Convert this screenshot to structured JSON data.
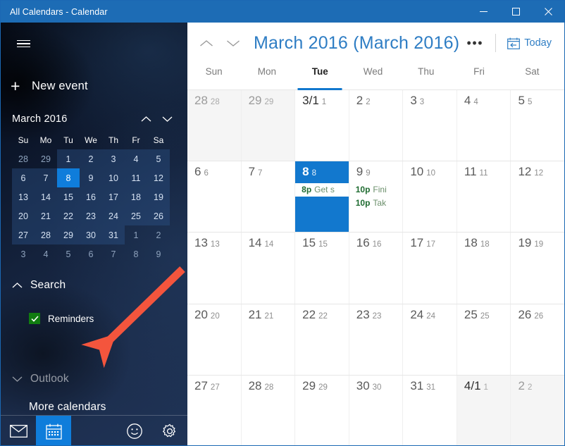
{
  "window": {
    "title": "All Calendars - Calendar",
    "controls": {
      "minimize": "minimize-icon",
      "maximize": "maximize-icon",
      "close": "close-icon"
    },
    "accent_color": "#1d6cb5"
  },
  "sidebar": {
    "menu_icon": "hamburger-icon",
    "new_event": {
      "icon": "plus-icon",
      "label": "New event"
    },
    "mini_calendar": {
      "month_label": "March 2016",
      "prev_icon": "chevron-up-icon",
      "next_icon": "chevron-down-icon",
      "weekday_headers": [
        "Su",
        "Mo",
        "Tu",
        "We",
        "Th",
        "Fr",
        "Sa"
      ],
      "weeks": [
        [
          {
            "d": "28",
            "m": "prev"
          },
          {
            "d": "29",
            "m": "prev"
          },
          {
            "d": "1",
            "m": "cur"
          },
          {
            "d": "2",
            "m": "cur"
          },
          {
            "d": "3",
            "m": "cur"
          },
          {
            "d": "4",
            "m": "cur"
          },
          {
            "d": "5",
            "m": "cur"
          }
        ],
        [
          {
            "d": "6",
            "m": "cur"
          },
          {
            "d": "7",
            "m": "cur"
          },
          {
            "d": "8",
            "m": "cur",
            "today": true
          },
          {
            "d": "9",
            "m": "cur"
          },
          {
            "d": "10",
            "m": "cur"
          },
          {
            "d": "11",
            "m": "cur"
          },
          {
            "d": "12",
            "m": "cur"
          }
        ],
        [
          {
            "d": "13",
            "m": "cur"
          },
          {
            "d": "14",
            "m": "cur"
          },
          {
            "d": "15",
            "m": "cur"
          },
          {
            "d": "16",
            "m": "cur"
          },
          {
            "d": "17",
            "m": "cur"
          },
          {
            "d": "18",
            "m": "cur"
          },
          {
            "d": "19",
            "m": "cur"
          }
        ],
        [
          {
            "d": "20",
            "m": "cur"
          },
          {
            "d": "21",
            "m": "cur"
          },
          {
            "d": "22",
            "m": "cur"
          },
          {
            "d": "23",
            "m": "cur"
          },
          {
            "d": "24",
            "m": "cur"
          },
          {
            "d": "25",
            "m": "cur"
          },
          {
            "d": "26",
            "m": "cur"
          }
        ],
        [
          {
            "d": "27",
            "m": "cur"
          },
          {
            "d": "28",
            "m": "cur"
          },
          {
            "d": "29",
            "m": "cur"
          },
          {
            "d": "30",
            "m": "cur"
          },
          {
            "d": "31",
            "m": "cur"
          },
          {
            "d": "1",
            "m": "next"
          },
          {
            "d": "2",
            "m": "next"
          }
        ],
        [
          {
            "d": "3",
            "m": "next"
          },
          {
            "d": "4",
            "m": "next"
          },
          {
            "d": "5",
            "m": "next"
          },
          {
            "d": "6",
            "m": "next"
          },
          {
            "d": "7",
            "m": "next"
          },
          {
            "d": "8",
            "m": "next"
          },
          {
            "d": "9",
            "m": "next"
          }
        ]
      ],
      "today_color": "#0f7ddb"
    },
    "search_section": {
      "label": "Search",
      "collapse_icon": "chevron-up-icon"
    },
    "calendars": [
      {
        "label": "Reminders",
        "checked": true,
        "color": "#107c10",
        "checkbox_icon": "checkmark-icon"
      }
    ],
    "clipped_section": {
      "label": "Outlook",
      "collapse_icon": "chevron-down-icon"
    },
    "more_calendars": "More calendars",
    "bottom_bar": [
      {
        "name": "mail",
        "icon": "mail-icon",
        "active": false
      },
      {
        "name": "calendar",
        "icon": "calendar-icon",
        "active": true
      },
      {
        "name": "feedback",
        "icon": "smiley-icon",
        "active": false
      },
      {
        "name": "settings",
        "icon": "gear-icon",
        "active": false
      }
    ],
    "annotation": {
      "type": "red-arrow",
      "color": "#f4553d",
      "points_to": "Reminders"
    }
  },
  "main": {
    "prev_icon": "chevron-up-icon",
    "next_icon": "chevron-down-icon",
    "title": "March 2016 (March 2016)",
    "title_color": "#2e7dc4",
    "overflow_label": "•••",
    "today_button": {
      "label": "Today",
      "icon": "calendar-back-icon"
    },
    "weekday_headers": [
      {
        "label": "Sun",
        "selected": false
      },
      {
        "label": "Mon",
        "selected": false
      },
      {
        "label": "Tue",
        "selected": true
      },
      {
        "label": "Wed",
        "selected": false
      },
      {
        "label": "Thu",
        "selected": false
      },
      {
        "label": "Fri",
        "selected": false
      },
      {
        "label": "Sat",
        "selected": false
      }
    ],
    "selection_color": "#1278ce",
    "weeks": [
      [
        {
          "main": "28",
          "sub": "28",
          "outside": true,
          "events": []
        },
        {
          "main": "29",
          "sub": "29",
          "outside": true,
          "events": []
        },
        {
          "main": "3/1",
          "sub": "1",
          "outside": false,
          "firstday": true,
          "events": []
        },
        {
          "main": "2",
          "sub": "2",
          "outside": false,
          "events": []
        },
        {
          "main": "3",
          "sub": "3",
          "outside": false,
          "events": []
        },
        {
          "main": "4",
          "sub": "4",
          "outside": false,
          "events": []
        },
        {
          "main": "5",
          "sub": "5",
          "outside": false,
          "events": []
        }
      ],
      [
        {
          "main": "6",
          "sub": "6",
          "outside": false,
          "events": []
        },
        {
          "main": "7",
          "sub": "7",
          "outside": false,
          "events": []
        },
        {
          "main": "8",
          "sub": "8",
          "outside": false,
          "selected": true,
          "events": [
            {
              "time": "8p",
              "title": "Get s"
            }
          ]
        },
        {
          "main": "9",
          "sub": "9",
          "outside": false,
          "events": [
            {
              "time": "10p",
              "title": "Fini"
            },
            {
              "time": "10p",
              "title": "Tak"
            }
          ]
        },
        {
          "main": "10",
          "sub": "10",
          "outside": false,
          "events": []
        },
        {
          "main": "11",
          "sub": "11",
          "outside": false,
          "events": []
        },
        {
          "main": "12",
          "sub": "12",
          "outside": false,
          "events": []
        }
      ],
      [
        {
          "main": "13",
          "sub": "13",
          "outside": false,
          "events": []
        },
        {
          "main": "14",
          "sub": "14",
          "outside": false,
          "events": []
        },
        {
          "main": "15",
          "sub": "15",
          "outside": false,
          "events": []
        },
        {
          "main": "16",
          "sub": "16",
          "outside": false,
          "events": []
        },
        {
          "main": "17",
          "sub": "17",
          "outside": false,
          "events": []
        },
        {
          "main": "18",
          "sub": "18",
          "outside": false,
          "events": []
        },
        {
          "main": "19",
          "sub": "19",
          "outside": false,
          "events": []
        }
      ],
      [
        {
          "main": "20",
          "sub": "20",
          "outside": false,
          "events": []
        },
        {
          "main": "21",
          "sub": "21",
          "outside": false,
          "events": []
        },
        {
          "main": "22",
          "sub": "22",
          "outside": false,
          "events": []
        },
        {
          "main": "23",
          "sub": "23",
          "outside": false,
          "events": []
        },
        {
          "main": "24",
          "sub": "24",
          "outside": false,
          "events": []
        },
        {
          "main": "25",
          "sub": "25",
          "outside": false,
          "events": []
        },
        {
          "main": "26",
          "sub": "26",
          "outside": false,
          "events": []
        }
      ],
      [
        {
          "main": "27",
          "sub": "27",
          "outside": false,
          "events": []
        },
        {
          "main": "28",
          "sub": "28",
          "outside": false,
          "events": []
        },
        {
          "main": "29",
          "sub": "29",
          "outside": false,
          "events": []
        },
        {
          "main": "30",
          "sub": "30",
          "outside": false,
          "events": []
        },
        {
          "main": "31",
          "sub": "31",
          "outside": false,
          "events": []
        },
        {
          "main": "4/1",
          "sub": "1",
          "outside": true,
          "firstday": true,
          "events": []
        },
        {
          "main": "2",
          "sub": "2",
          "outside": true,
          "events": []
        }
      ]
    ]
  }
}
